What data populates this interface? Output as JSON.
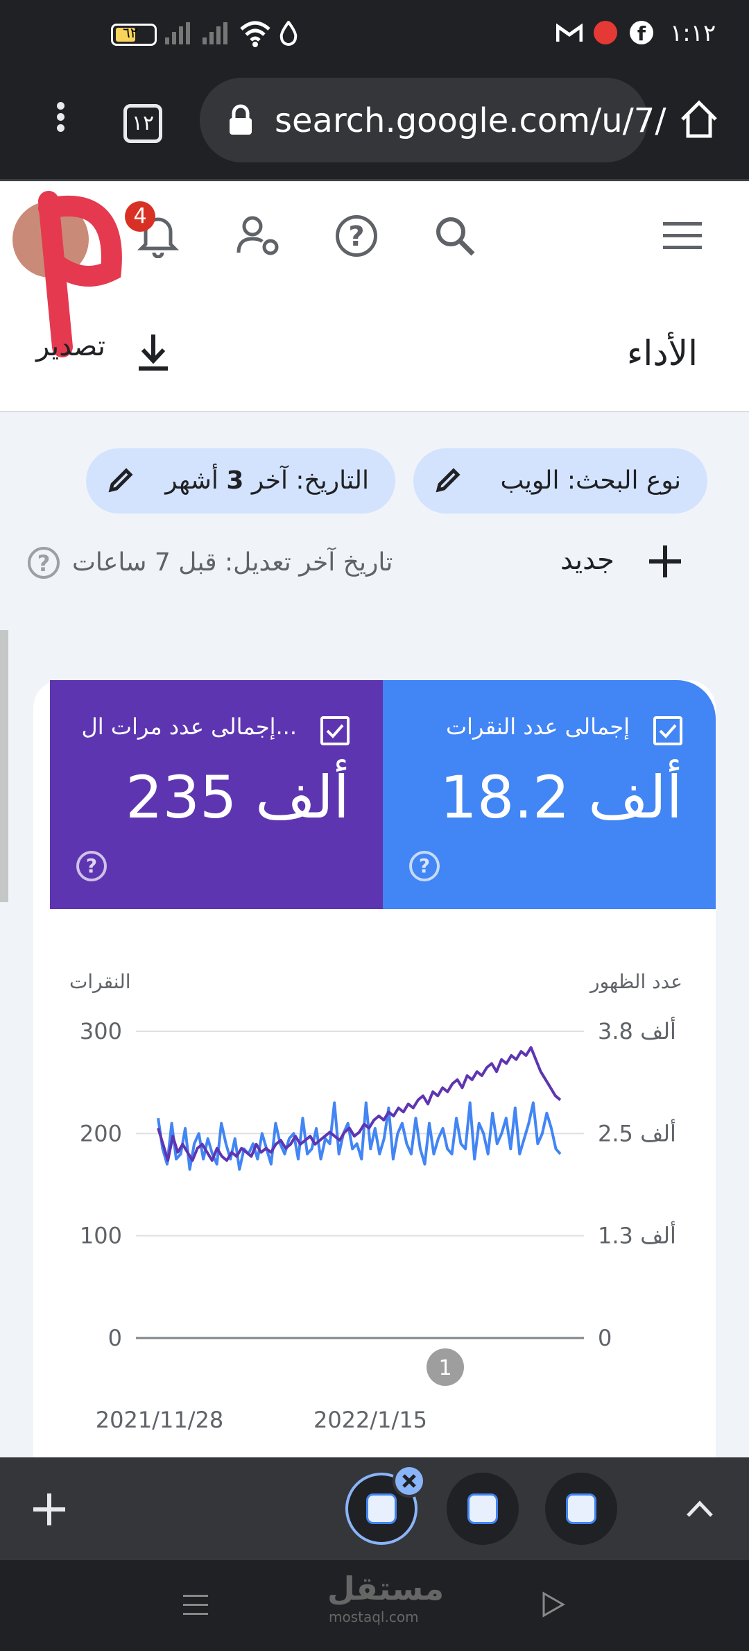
{
  "status_bar": {
    "time": "١:١٢",
    "battery": "٦٢"
  },
  "browser": {
    "url": "search.google.com/u/7/",
    "tab_count": "١٢"
  },
  "header": {
    "notification_count": "4",
    "page_title": "الأداء",
    "export_label": "تصدير"
  },
  "filters": {
    "search_type": "نوع البحث: الويب",
    "date_prefix": "التاريخ: آخر ",
    "date_number": "3",
    "date_suffix": " أشهر"
  },
  "toolbar": {
    "new_label": "جديد",
    "last_updated": "تاريخ آخر تعديل: قبل 7 ساعات"
  },
  "metrics": {
    "clicks_label": "إجمالى عدد النقرات",
    "clicks_value": "18.2 ألف",
    "impressions_label": "إجمالى عدد مرات ال...",
    "impressions_value": "235 ألف"
  },
  "colors": {
    "clicks": "#4285f4",
    "impressions": "#5e35b1"
  },
  "chart_data": {
    "type": "line",
    "left_axis_label": "النقرات",
    "right_axis_label": "عدد الظهور",
    "left_ticks": [
      "300",
      "200",
      "100",
      "0"
    ],
    "right_ticks": [
      "3.8 ألف",
      "2.5 ألف",
      "1.3 ألف",
      "0"
    ],
    "x_tick_labels": [
      "2021/11/28",
      "2022/1/15"
    ],
    "annotation": "1",
    "ylim_left": [
      0,
      300
    ],
    "ylim_right": [
      0,
      3.8
    ],
    "grid": true,
    "series": [
      {
        "axis": "left",
        "color": "#4285f4",
        "values": [
          215,
          185,
          170,
          210,
          175,
          180,
          205,
          165,
          190,
          200,
          175,
          195,
          180,
          170,
          210,
          190,
          175,
          195,
          165,
          185,
          180,
          190,
          175,
          200,
          185,
          170,
          210,
          190,
          180,
          195,
          200,
          175,
          215,
          180,
          185,
          205,
          175,
          195,
          190,
          230,
          180,
          200,
          210,
          185,
          190,
          175,
          230,
          185,
          205,
          180,
          195,
          225,
          175,
          200,
          210,
          190,
          180,
          215,
          185,
          170,
          210,
          180,
          195,
          205,
          185,
          180,
          215,
          190,
          185,
          230,
          175,
          210,
          200,
          180,
          220,
          190,
          200,
          215,
          185,
          225,
          180,
          195,
          210,
          230,
          190,
          200,
          220,
          205,
          185,
          180
        ]
      },
      {
        "axis": "right",
        "color": "#5e35b1",
        "values": [
          2.6,
          2.4,
          2.2,
          2.5,
          2.3,
          2.4,
          2.3,
          2.2,
          2.35,
          2.4,
          2.3,
          2.2,
          2.35,
          2.25,
          2.2,
          2.3,
          2.25,
          2.35,
          2.3,
          2.25,
          2.4,
          2.3,
          2.35,
          2.3,
          2.4,
          2.45,
          2.35,
          2.4,
          2.5,
          2.4,
          2.45,
          2.5,
          2.4,
          2.45,
          2.5,
          2.55,
          2.5,
          2.45,
          2.55,
          2.6,
          2.5,
          2.55,
          2.65,
          2.6,
          2.7,
          2.75,
          2.7,
          2.8,
          2.75,
          2.85,
          2.8,
          2.9,
          2.85,
          2.95,
          3.0,
          2.9,
          3.05,
          3.0,
          3.1,
          3.05,
          3.15,
          3.2,
          3.1,
          3.25,
          3.2,
          3.3,
          3.25,
          3.35,
          3.4,
          3.3,
          3.45,
          3.4,
          3.5,
          3.45,
          3.55,
          3.5,
          3.6,
          3.45,
          3.3,
          3.2,
          3.1,
          3.0,
          2.95
        ]
      }
    ]
  },
  "bottom": {
    "watermark": "مستقل",
    "watermark_sub": "mostaql.com"
  }
}
